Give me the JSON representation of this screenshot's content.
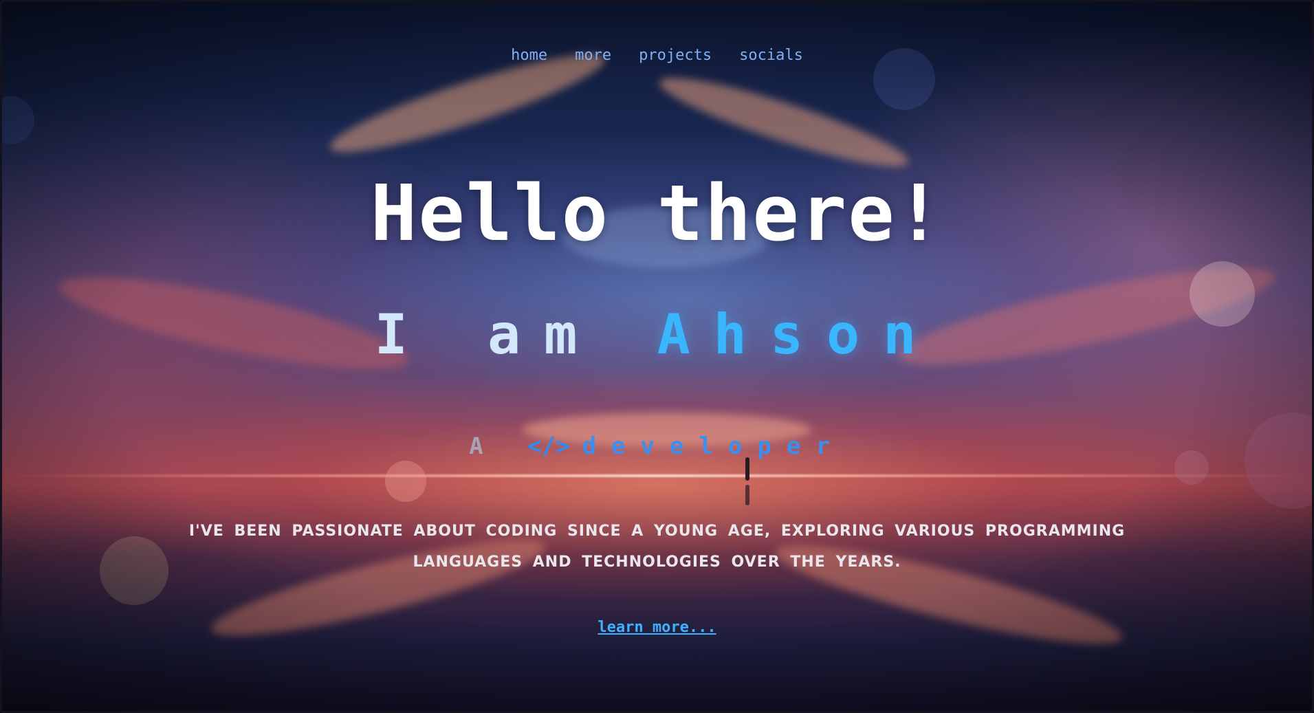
{
  "nav": {
    "items": [
      {
        "label": "home"
      },
      {
        "label": "more"
      },
      {
        "label": "projects"
      },
      {
        "label": "socials"
      }
    ]
  },
  "hero": {
    "greeting": "Hello there!",
    "intro_prefix": "I am",
    "name": "Ahson",
    "role_article": "A",
    "role_icon": "code-icon",
    "role_icon_glyph": "</>",
    "role": "developer"
  },
  "about": {
    "text": "I've been passionate about coding since a young age, exploring various programming languages and technologies over the years."
  },
  "cta": {
    "label": "learn more..."
  },
  "colors": {
    "nav_link": "#7fb0f5",
    "accent": "#3ab6ff",
    "greeting": "#ffffff",
    "body_text": "#e9e6ee"
  }
}
